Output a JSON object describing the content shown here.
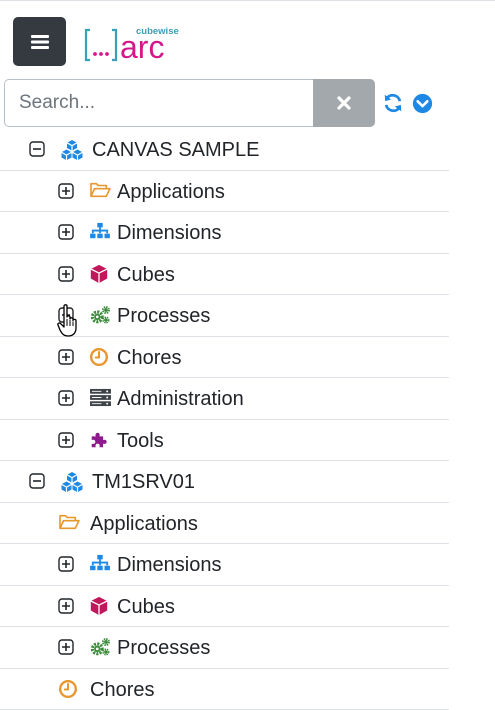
{
  "header": {
    "logo_small": "cubewise",
    "logo_main": "arc"
  },
  "search": {
    "placeholder": "Search..."
  },
  "tree": [
    {
      "label": "CANVAS SAMPLE",
      "icon": "cubes-icon",
      "level": 0,
      "toggle": "minus"
    },
    {
      "label": "Applications",
      "icon": "folder-open-icon",
      "level": 1,
      "toggle": "plus"
    },
    {
      "label": "Dimensions",
      "icon": "sitemap-icon",
      "level": 1,
      "toggle": "plus"
    },
    {
      "label": "Cubes",
      "icon": "cube-icon",
      "level": 1,
      "toggle": "plus"
    },
    {
      "label": "Processes",
      "icon": "cogs-icon",
      "level": 1,
      "toggle": "plus"
    },
    {
      "label": "Chores",
      "icon": "clock-icon",
      "level": 1,
      "toggle": "plus"
    },
    {
      "label": "Administration",
      "icon": "server-icon",
      "level": 1,
      "toggle": "plus"
    },
    {
      "label": "Tools",
      "icon": "puzzle-icon",
      "level": 1,
      "toggle": "plus"
    },
    {
      "label": "TM1SRV01",
      "icon": "cubes-icon",
      "level": 0,
      "toggle": "minus"
    },
    {
      "label": "Applications",
      "icon": "folder-open-icon",
      "level": 1,
      "toggle": "none"
    },
    {
      "label": "Dimensions",
      "icon": "sitemap-icon",
      "level": 1,
      "toggle": "plus"
    },
    {
      "label": "Cubes",
      "icon": "cube-icon",
      "level": 1,
      "toggle": "plus"
    },
    {
      "label": "Processes",
      "icon": "cogs-icon",
      "level": 1,
      "toggle": "plus"
    },
    {
      "label": "Chores",
      "icon": "clock-icon",
      "level": 1,
      "toggle": "none"
    }
  ],
  "colors": {
    "menu_button": "#343a40",
    "clear_button": "#a3a8ad",
    "accent_blue": "#1e88e5",
    "logo_teal": "#3aa0b5",
    "logo_magenta": "#d6178a",
    "folder_orange": "#e8962e",
    "cube_magenta": "#c2185b",
    "cogs_green": "#3a8a3a",
    "puzzle_purple": "#8e1a8e"
  }
}
